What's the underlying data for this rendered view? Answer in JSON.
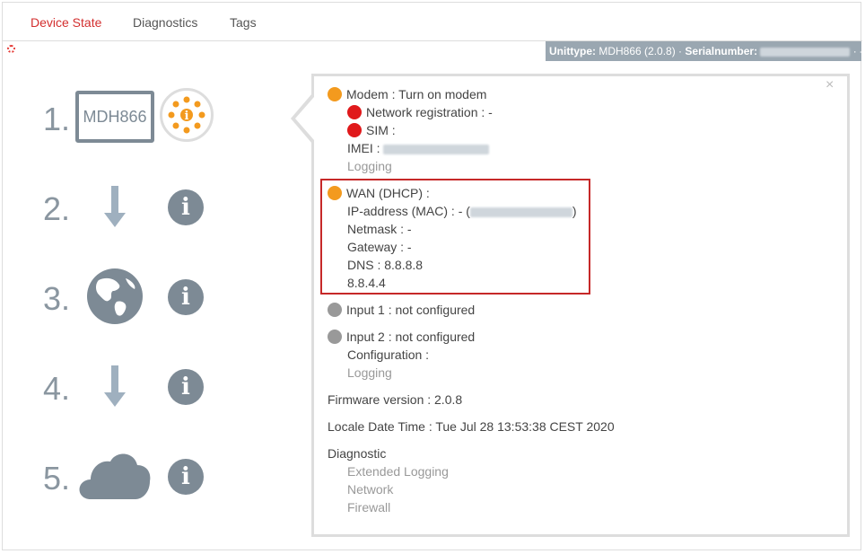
{
  "tabs": [
    {
      "label": "Device State",
      "active": true
    },
    {
      "label": "Diagnostics",
      "active": false
    },
    {
      "label": "Tags",
      "active": false
    }
  ],
  "unitbar": {
    "unittype_label": "Unittype:",
    "unittype_value": "MDH866 (2.0.8)",
    "serial_label": "Serialnumber:"
  },
  "steps": {
    "s1": "1.",
    "s2": "2.",
    "s3": "3.",
    "s4": "4.",
    "s5": "5.",
    "modem_model": "MDH866",
    "info_glyph": "i"
  },
  "colors": {
    "accent": "#d32f2f",
    "orange": "#f39a1e",
    "red": "#e0191b",
    "grey": "#999999",
    "icon": "#7d8a95"
  },
  "panel": {
    "close": "×",
    "modem": "Modem : Turn on modem",
    "network_registration": "Network registration : -",
    "sim": "SIM :",
    "imei_label": "IMEI :",
    "modem_logging": "Logging",
    "wan_title": "WAN (DHCP) :",
    "ip_label": "IP-address (MAC) : - (",
    "ip_close": ")",
    "netmask": "Netmask : -",
    "gateway": "Gateway : -",
    "dns1": "DNS : 8.8.8.8",
    "dns2": "8.8.4.4",
    "input1": "Input 1 : not configured",
    "input2": "Input 2 : not configured",
    "configuration": "Configuration :",
    "input_logging": "Logging",
    "firmware": "Firmware version : 2.0.8",
    "locale_time": "Locale Date Time : Tue Jul 28 13:53:38 CEST 2020",
    "diagnostic": "Diagnostic",
    "extended_logging": "Extended Logging",
    "network": "Network",
    "firewall": "Firewall"
  }
}
